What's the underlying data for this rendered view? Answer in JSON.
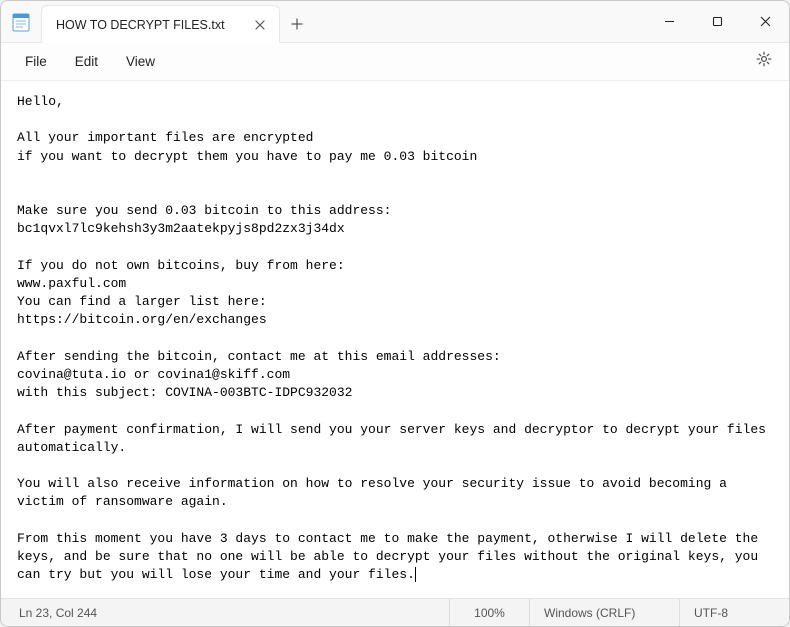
{
  "tab": {
    "title": "HOW TO DECRYPT FILES.txt"
  },
  "menu": {
    "file": "File",
    "edit": "Edit",
    "view": "View"
  },
  "document": {
    "text": "Hello,\n\nAll your important files are encrypted\nif you want to decrypt them you have to pay me 0.03 bitcoin\n\n\nMake sure you send 0.03 bitcoin to this address:\nbc1qvxl7lc9kehsh3y3m2aatekpyjs8pd2zx3j34dx\n\nIf you do not own bitcoins, buy from here:\nwww.paxful.com\nYou can find a larger list here:\nhttps://bitcoin.org/en/exchanges\n\nAfter sending the bitcoin, contact me at this email addresses:\ncovina@tuta.io or covina1@skiff.com\nwith this subject: COVINA-003BTC-IDPC932032\n\nAfter payment confirmation, I will send you your server keys and decryptor to decrypt your files automatically.\n\nYou will also receive information on how to resolve your security issue to avoid becoming a victim of ransomware again.\n\nFrom this moment you have 3 days to contact me to make the payment, otherwise I will delete the keys, and be sure that no one will be able to decrypt your files without the original keys, you can try but you will lose your time and your files."
  },
  "status": {
    "position": "Ln 23, Col 244",
    "zoom": "100%",
    "eol": "Windows (CRLF)",
    "encoding": "UTF-8"
  }
}
